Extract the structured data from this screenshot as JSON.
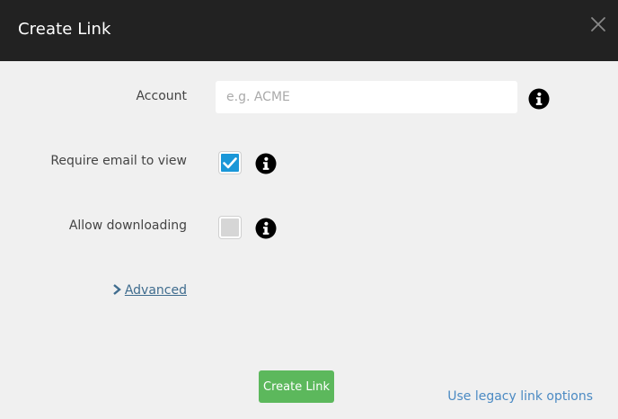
{
  "dialog": {
    "title": "Create Link",
    "close_icon": "close-icon"
  },
  "form": {
    "account": {
      "label": "Account",
      "value": "",
      "placeholder": "e.g. ACME",
      "info_icon": "info-icon"
    },
    "require_email": {
      "label": "Require email to view",
      "checked": true,
      "info_icon": "info-icon"
    },
    "allow_downloading": {
      "label": "Allow downloading",
      "checked": false,
      "info_icon": "info-icon"
    },
    "advanced": {
      "label": "Advanced",
      "icon": "chevron-right-icon"
    }
  },
  "footer": {
    "create_label": "Create Link",
    "legacy_label": "Use legacy link options"
  },
  "colors": {
    "header_bg": "#222222",
    "body_bg": "#f0f0f0",
    "primary_button": "#5cb85c",
    "checkbox_checked": "#1a97d8",
    "link": "#4b8ac3"
  }
}
